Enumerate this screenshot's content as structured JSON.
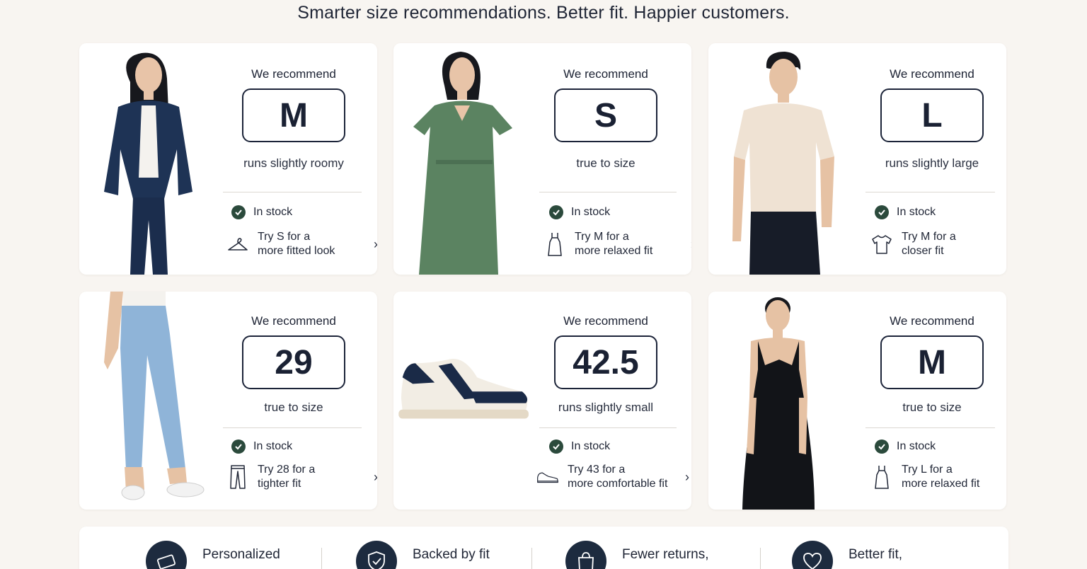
{
  "headline": "Smarter size recommendations. Better fit. Happier customers.",
  "cards": [
    {
      "product": "denim jacket and jeans",
      "label": "We recommend",
      "size": "M",
      "note": "runs slightly roomy",
      "stock": "In stock",
      "alt_line1": "Try S for a",
      "alt_line2": "more fitted look",
      "alt_icon": "hanger-icon"
    },
    {
      "product": "green wrap dress",
      "label": "We recommend",
      "size": "S",
      "note": "true to size",
      "stock": "In stock",
      "alt_line1": "Try M for a",
      "alt_line2": "more relaxed fit",
      "alt_icon": "dress-icon"
    },
    {
      "product": "beige polo shirt",
      "label": "We recommend",
      "size": "L",
      "note": "runs slightly large",
      "stock": "In stock",
      "alt_line1": "Try M for a",
      "alt_line2": "closer fit",
      "alt_icon": "tshirt-icon"
    },
    {
      "product": "light blue jeans",
      "label": "We recommend",
      "size": "29",
      "note": "true to size",
      "stock": "In stock",
      "alt_line1": "Try 28 for a",
      "alt_line2": "tighter fit",
      "alt_icon": "jeans-icon"
    },
    {
      "product": "navy sneaker",
      "label": "We recommend",
      "size": "42.5",
      "note": "runs slightly small",
      "stock": "In stock",
      "alt_line1": "Try 43 for a",
      "alt_line2": "more comfortable fit",
      "alt_icon": "sneaker-icon"
    },
    {
      "product": "black slip dress",
      "label": "We recommend",
      "size": "M",
      "note": "true to size",
      "stock": "In stock",
      "alt_line1": "Try L for a",
      "alt_line2": "more relaxed fit",
      "alt_icon": "dress-icon"
    }
  ],
  "features": [
    {
      "text": "Personalized",
      "icon": "ruler-card-icon"
    },
    {
      "text": "Backed by fit",
      "icon": "shield-check-icon"
    },
    {
      "text": "Fewer returns,",
      "icon": "shopping-bag-icon"
    },
    {
      "text": "Better fit,",
      "icon": "heart-icon"
    }
  ],
  "colors": {
    "accent": "#1d2b3f",
    "check": "#2b4a3c",
    "background": "#f8f5f1"
  }
}
